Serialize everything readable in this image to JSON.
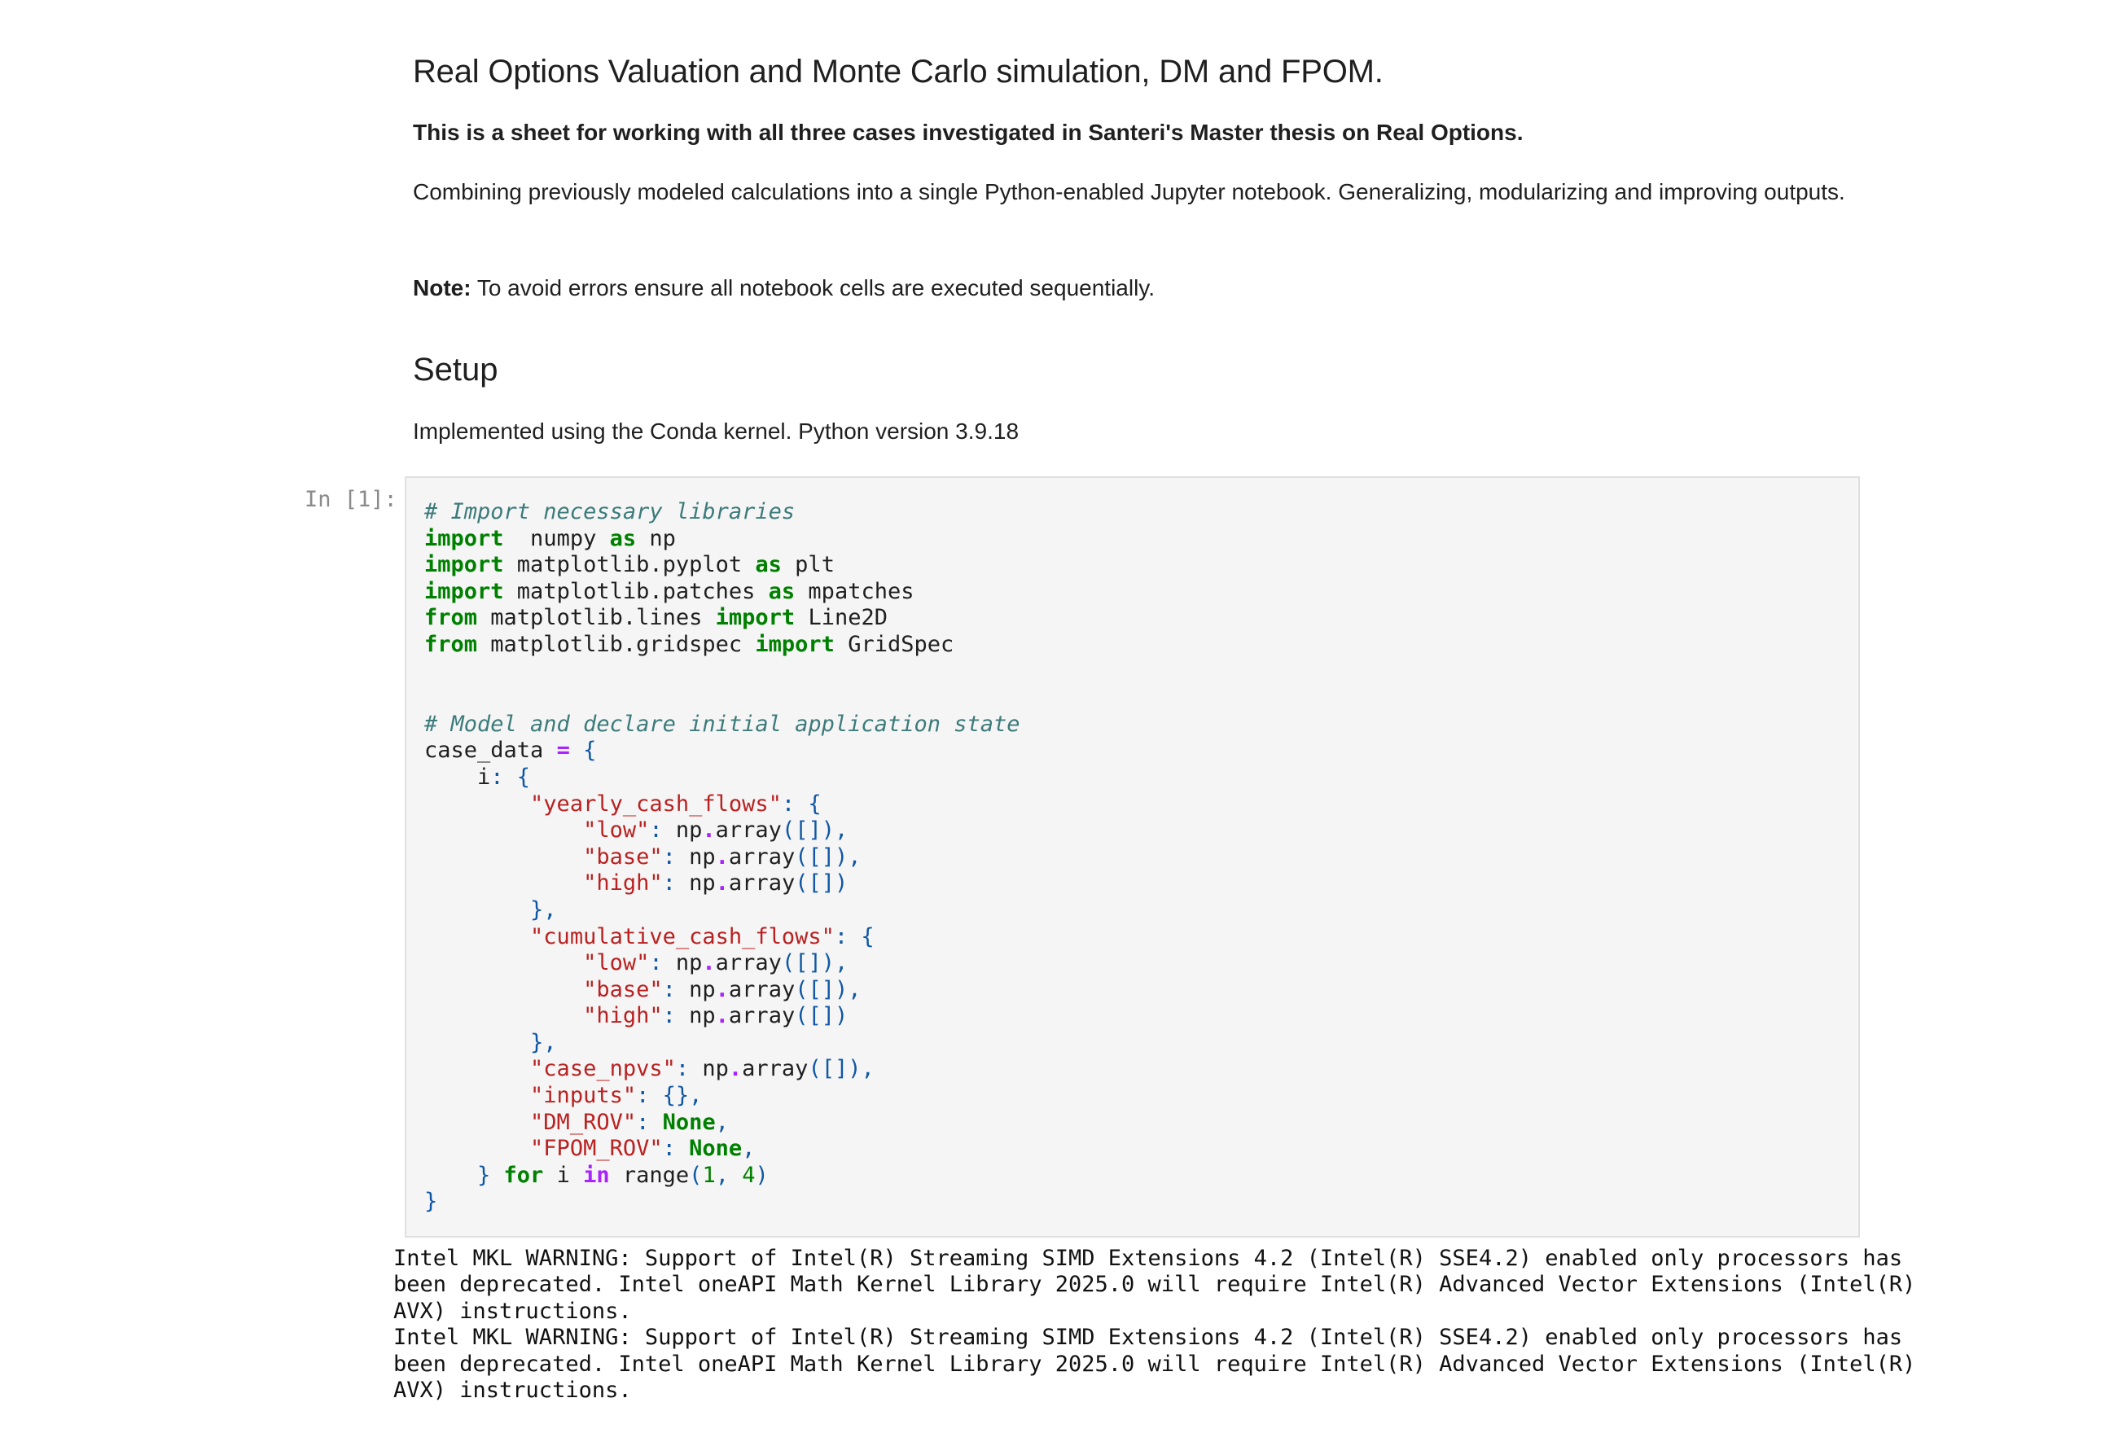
{
  "markdown": {
    "title": "Real Options Valuation and Monte Carlo simulation, DM and FPOM.",
    "subtitle": "This is a sheet for working with all three cases investigated in Santeri's Master thesis on Real Options.",
    "paragraph1": "Combining previously modeled calculations into a single Python-enabled Jupyter notebook. Generalizing, modularizing and improving outputs.",
    "note_label": "Note:",
    "note_text": " To avoid errors ensure all notebook cells are executed sequentially.",
    "setup_heading": "Setup",
    "setup_text": "Implemented using the Conda kernel. Python version 3.9.18"
  },
  "cell": {
    "prompt": "In [1]:",
    "code_lines": [
      [
        [
          "cm",
          "# Import necessary libraries"
        ]
      ],
      [
        [
          "kw",
          "import"
        ],
        [
          "",
          "  numpy "
        ],
        [
          "kw",
          "as"
        ],
        [
          "",
          " np"
        ]
      ],
      [
        [
          "kw",
          "import"
        ],
        [
          "",
          " matplotlib.pyplot "
        ],
        [
          "kw",
          "as"
        ],
        [
          "",
          " plt"
        ]
      ],
      [
        [
          "kw",
          "import"
        ],
        [
          "",
          " matplotlib.patches "
        ],
        [
          "kw",
          "as"
        ],
        [
          "",
          " mpatches"
        ]
      ],
      [
        [
          "kw",
          "from"
        ],
        [
          "",
          " matplotlib.lines "
        ],
        [
          "kw",
          "import"
        ],
        [
          "",
          " Line2D"
        ]
      ],
      [
        [
          "kw",
          "from"
        ],
        [
          "",
          " matplotlib.gridspec "
        ],
        [
          "kw",
          "import"
        ],
        [
          "",
          " GridSpec"
        ]
      ],
      [],
      [],
      [
        [
          "cm",
          "# Model and declare initial application state"
        ]
      ],
      [
        [
          "",
          "case_data "
        ],
        [
          "op",
          "="
        ],
        [
          "pu",
          " {"
        ]
      ],
      [
        [
          "",
          "    i"
        ],
        [
          "pu",
          ": {"
        ]
      ],
      [
        [
          "",
          "        "
        ],
        [
          "st",
          "\"yearly_cash_flows\""
        ],
        [
          "pu",
          ": {"
        ]
      ],
      [
        [
          "",
          "            "
        ],
        [
          "st",
          "\"low\""
        ],
        [
          "pu",
          ": "
        ],
        [
          "",
          "np"
        ],
        [
          "op",
          "."
        ],
        [
          "",
          "array"
        ],
        [
          "pu",
          "([]),"
        ]
      ],
      [
        [
          "",
          "            "
        ],
        [
          "st",
          "\"base\""
        ],
        [
          "pu",
          ": "
        ],
        [
          "",
          "np"
        ],
        [
          "op",
          "."
        ],
        [
          "",
          "array"
        ],
        [
          "pu",
          "([]),"
        ]
      ],
      [
        [
          "",
          "            "
        ],
        [
          "st",
          "\"high\""
        ],
        [
          "pu",
          ": "
        ],
        [
          "",
          "np"
        ],
        [
          "op",
          "."
        ],
        [
          "",
          "array"
        ],
        [
          "pu",
          "([])"
        ]
      ],
      [
        [
          "",
          "        "
        ],
        [
          "pu",
          "},"
        ]
      ],
      [
        [
          "",
          "        "
        ],
        [
          "st",
          "\"cumulative_cash_flows\""
        ],
        [
          "pu",
          ": {"
        ]
      ],
      [
        [
          "",
          "            "
        ],
        [
          "st",
          "\"low\""
        ],
        [
          "pu",
          ": "
        ],
        [
          "",
          "np"
        ],
        [
          "op",
          "."
        ],
        [
          "",
          "array"
        ],
        [
          "pu",
          "([]),"
        ]
      ],
      [
        [
          "",
          "            "
        ],
        [
          "st",
          "\"base\""
        ],
        [
          "pu",
          ": "
        ],
        [
          "",
          "np"
        ],
        [
          "op",
          "."
        ],
        [
          "",
          "array"
        ],
        [
          "pu",
          "([]),"
        ]
      ],
      [
        [
          "",
          "            "
        ],
        [
          "st",
          "\"high\""
        ],
        [
          "pu",
          ": "
        ],
        [
          "",
          "np"
        ],
        [
          "op",
          "."
        ],
        [
          "",
          "array"
        ],
        [
          "pu",
          "([])"
        ]
      ],
      [
        [
          "",
          "        "
        ],
        [
          "pu",
          "},"
        ]
      ],
      [
        [
          "",
          "        "
        ],
        [
          "st",
          "\"case_npvs\""
        ],
        [
          "pu",
          ": "
        ],
        [
          "",
          "np"
        ],
        [
          "op",
          "."
        ],
        [
          "",
          "array"
        ],
        [
          "pu",
          "([]),"
        ]
      ],
      [
        [
          "",
          "        "
        ],
        [
          "st",
          "\"inputs\""
        ],
        [
          "pu",
          ": {},"
        ]
      ],
      [
        [
          "",
          "        "
        ],
        [
          "st",
          "\"DM_ROV\""
        ],
        [
          "pu",
          ": "
        ],
        [
          "kw",
          "None"
        ],
        [
          "pu",
          ","
        ]
      ],
      [
        [
          "",
          "        "
        ],
        [
          "st",
          "\"FPOM_ROV\""
        ],
        [
          "pu",
          ": "
        ],
        [
          "kw",
          "None"
        ],
        [
          "pu",
          ","
        ]
      ],
      [
        [
          "",
          "    "
        ],
        [
          "pu",
          "} "
        ],
        [
          "kw",
          "for"
        ],
        [
          "",
          " i "
        ],
        [
          "op",
          "in"
        ],
        [
          "",
          " range"
        ],
        [
          "pu",
          "("
        ],
        [
          "nu",
          "1"
        ],
        [
          "pu",
          ", "
        ],
        [
          "nu",
          "4"
        ],
        [
          "pu",
          ")"
        ]
      ],
      [
        [
          "pu",
          "}"
        ]
      ]
    ]
  },
  "output": {
    "text": "Intel MKL WARNING: Support of Intel(R) Streaming SIMD Extensions 4.2 (Intel(R) SSE4.2) enabled only processors has\nbeen deprecated. Intel oneAPI Math Kernel Library 2025.0 will require Intel(R) Advanced Vector Extensions (Intel(R)\nAVX) instructions.\nIntel MKL WARNING: Support of Intel(R) Streaming SIMD Extensions 4.2 (Intel(R) SSE4.2) enabled only processors has\nbeen deprecated. Intel oneAPI Math Kernel Library 2025.0 will require Intel(R) Advanced Vector Extensions (Intel(R)\nAVX) instructions."
  }
}
